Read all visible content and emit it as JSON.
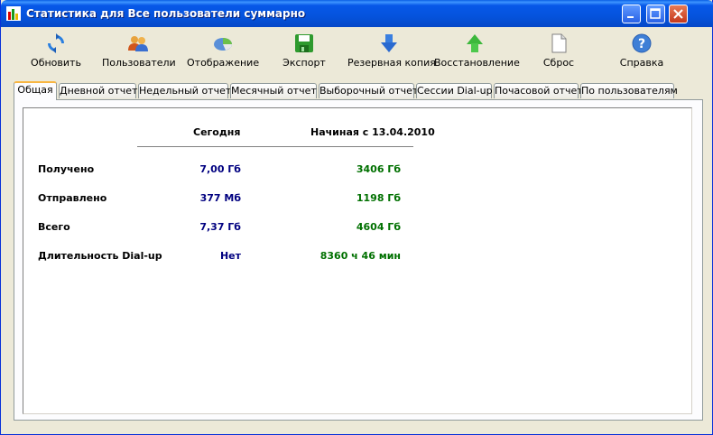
{
  "window": {
    "title": "Статистика для Все пользователи суммарно"
  },
  "toolbar": {
    "items": [
      {
        "label": "Обновить",
        "icon": "refresh-icon"
      },
      {
        "label": "Пользователи",
        "icon": "users-icon"
      },
      {
        "label": "Отображение",
        "icon": "display-icon"
      },
      {
        "label": "Экспорт",
        "icon": "save-icon"
      },
      {
        "label": "Резервная копия",
        "icon": "arrow-down-icon"
      },
      {
        "label": "Восстановление",
        "icon": "arrow-up-icon"
      },
      {
        "label": "Сброс",
        "icon": "blank-page-icon"
      },
      {
        "label": "Справка",
        "icon": "help-icon"
      }
    ]
  },
  "tabs": [
    {
      "label": "Общая",
      "active": true
    },
    {
      "label": "Дневной отчет"
    },
    {
      "label": "Недельный отчет"
    },
    {
      "label": "Месячный отчет"
    },
    {
      "label": "Выборочный отчет"
    },
    {
      "label": "Сессии Dial-up"
    },
    {
      "label": "Почасовой отчет"
    },
    {
      "label": "По пользователям"
    }
  ],
  "summary": {
    "col_today": "Сегодня",
    "col_since": "Начиная с 13.04.2010",
    "rows": [
      {
        "label": "Получено",
        "today": "7,00 Гб",
        "since": "3406 Гб"
      },
      {
        "label": "Отправлено",
        "today": "377 Мб",
        "since": "1198 Гб"
      },
      {
        "label": "Всего",
        "today": "7,37 Гб",
        "since": "4604 Гб"
      },
      {
        "label": "Длительность Dial-up",
        "today": "Нет",
        "since": "8360 ч 46 мин"
      }
    ]
  },
  "colors": {
    "today_value": "#000080",
    "since_value": "#007000",
    "titlebar": "#0553dd"
  }
}
